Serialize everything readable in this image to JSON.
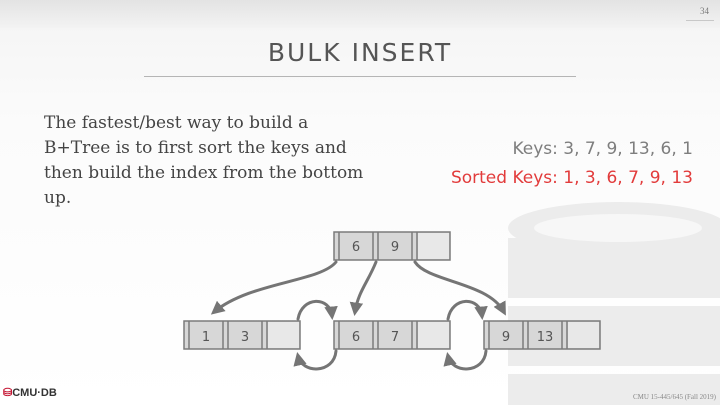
{
  "slide": {
    "number": "34",
    "title": "BULK INSERT"
  },
  "body": {
    "lines": [
      "The fastest/best way to build a",
      "B+Tree is to first sort the keys and",
      "then build the index from the bottom",
      "up."
    ],
    "keys": "Keys: 3, 7, 9, 13, 6, 1",
    "sorted_keys": "Sorted Keys: 1, 3, 6, 7, 9, 13"
  },
  "tree": {
    "root": {
      "keys": [
        "6",
        "9",
        ""
      ]
    },
    "leaves": [
      {
        "keys": [
          "1",
          "3",
          ""
        ]
      },
      {
        "keys": [
          "6",
          "7",
          ""
        ]
      },
      {
        "keys": [
          "9",
          "13",
          ""
        ]
      }
    ]
  },
  "footer": {
    "logo": "CMU·DB",
    "course": "CMU 15-445/645 (Fall 2019)"
  },
  "colors": {
    "highlight": "#e23b3b",
    "node_fill": "#d7d7d7",
    "arrow": "#757575"
  }
}
